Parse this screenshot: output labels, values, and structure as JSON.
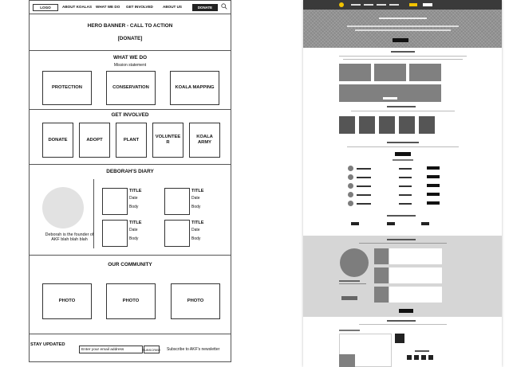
{
  "wireframe": {
    "nav": {
      "logo": "LOGO",
      "items": [
        "ABOUT KOALAS",
        "WHAT WE DO",
        "GET INVOLVED",
        "ABOUT US"
      ],
      "donate": "DONATE"
    },
    "hero": {
      "title": "HERO BANNER - CALL TO ACTION",
      "cta": "[DONATE]"
    },
    "what_we_do": {
      "title": "WHAT WE DO",
      "subtitle": "Mission statement",
      "boxes": [
        "PROTECTION",
        "CONSERVATION",
        "KOALA MAPPING"
      ]
    },
    "get_involved": {
      "title": "GET INVOLVED",
      "boxes": [
        "DONATE",
        "ADOPT",
        "PLANT",
        "VOLUNTEE R",
        "KOALA ARMY"
      ]
    },
    "diary": {
      "title": "DEBORAH'S DIARY",
      "caption": "Deborah is the founder of AKF blah blah blah",
      "card_title": "TITLE",
      "card_date": "Date",
      "card_body": "Body"
    },
    "community": {
      "title": "OUR COMMUNITY",
      "photos": [
        "PHOTO",
        "PHOTO",
        "PHOTO"
      ]
    },
    "footer": {
      "title": "STAY UPDATED",
      "placeholder": "Enter your email address",
      "subscribe": "SUBSCRIBE",
      "note": "Subscribe to AKF's newsletter"
    }
  }
}
